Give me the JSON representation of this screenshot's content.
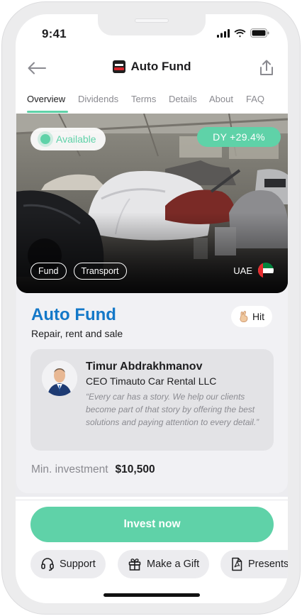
{
  "status": {
    "time": "9:41"
  },
  "header": {
    "title": "Auto Fund"
  },
  "tabs": [
    {
      "label": "Overview",
      "active": true
    },
    {
      "label": "Dividends",
      "active": false
    },
    {
      "label": "Terms",
      "active": false
    },
    {
      "label": "Details",
      "active": false
    },
    {
      "label": "About",
      "active": false
    },
    {
      "label": "FAQ",
      "active": false
    }
  ],
  "hero": {
    "availability": "Available",
    "dividend_yield": "DY +29.4%",
    "tags": [
      "Fund",
      "Transport"
    ],
    "country": "UAE"
  },
  "fund": {
    "name": "Auto Fund",
    "subtitle": "Repair, rent and sale",
    "hit_label": "Hit",
    "hit_icon": "hand-sign-icon"
  },
  "person": {
    "name": "Timur Abdrakhmanov",
    "role": "CEO Timauto Car Rental LLC",
    "quote": "“Every car has a story. We help our clients become part of that story by offering the best solutions and paying attention to every detail.”"
  },
  "investment": {
    "label": "Min. investment",
    "value": "$10,500"
  },
  "actions": {
    "invest": "Invest now",
    "support": "Support",
    "gift": "Make a Gift",
    "presentation": "Presents"
  },
  "colors": {
    "accent": "#5fd2a8",
    "title_blue": "#1478c8"
  }
}
